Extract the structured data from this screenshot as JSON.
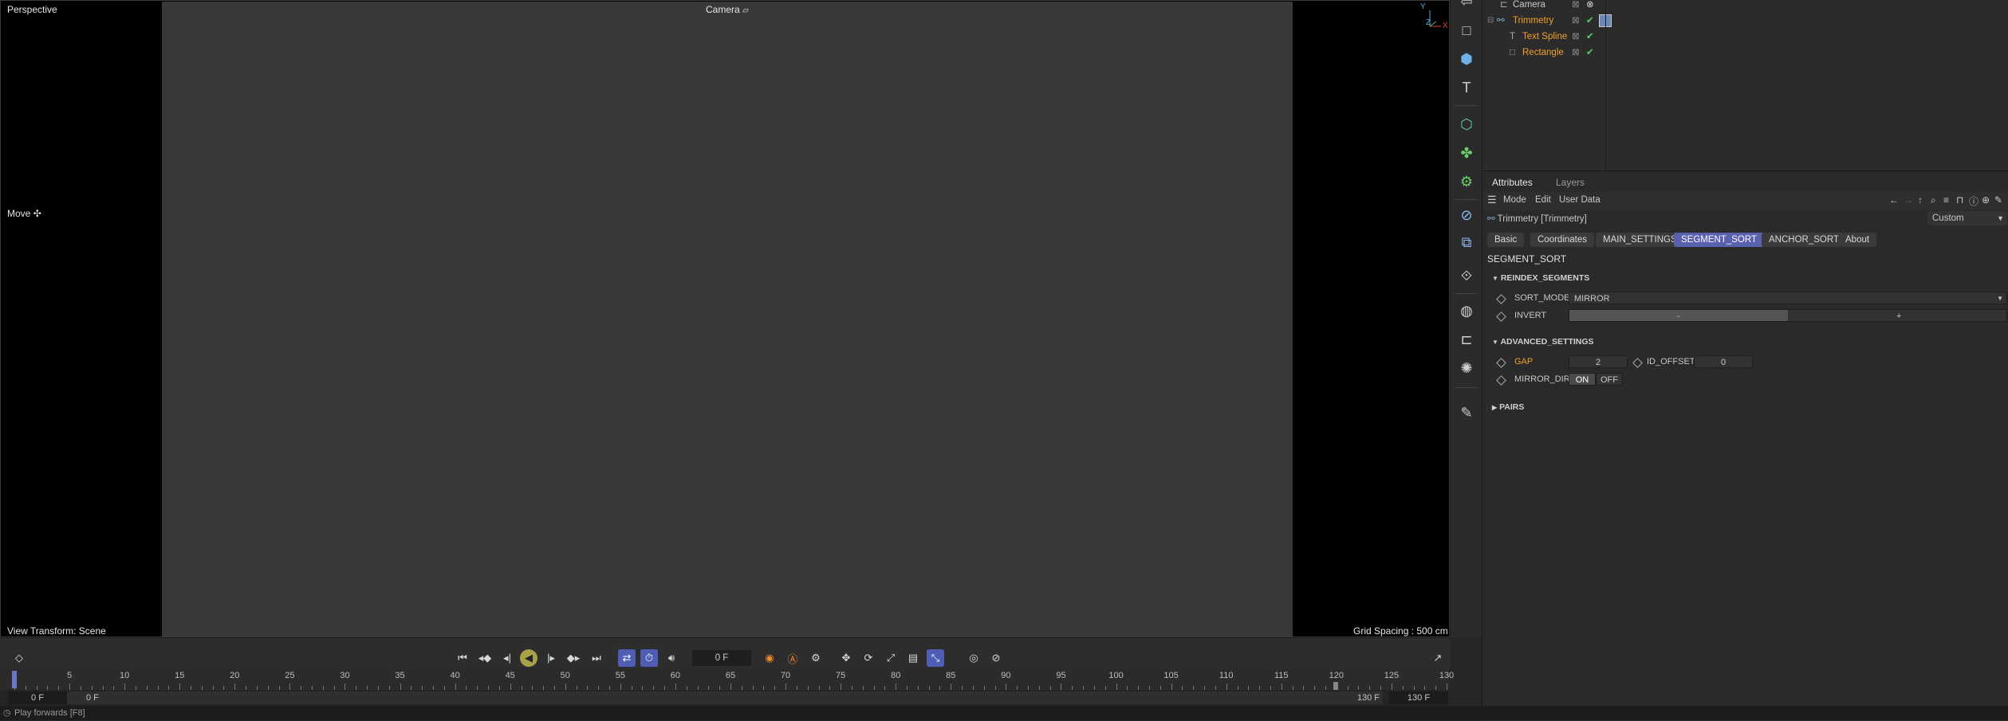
{
  "viewport": {
    "view_name": "Perspective",
    "camera_label": "Camera",
    "tool_label": "Move",
    "view_transform": "View Transform: Scene",
    "grid_spacing": "Grid Spacing : 500 cm",
    "axis_y": "Y",
    "axis_z": "Z",
    "axis_x": "X"
  },
  "object_manager": {
    "rows": [
      {
        "name": "Camera",
        "color": "#d8d8d8"
      },
      {
        "name": "Trimmetry",
        "color": "#f0a030"
      },
      {
        "name": "Text Spline",
        "color": "#f0a030"
      },
      {
        "name": "Rectangle",
        "color": "#f0a030"
      }
    ]
  },
  "attributes": {
    "tabs": [
      "Attributes",
      "Layers"
    ],
    "menu": [
      "Mode",
      "Edit",
      "User Data"
    ],
    "object_title": "Trimmetry [Trimmetry]",
    "preset": "Custom",
    "pills": [
      "Basic",
      "Coordinates",
      "MAIN_SETTINGS",
      "SEGMENT_SORT",
      "ANCHOR_SORT",
      "About"
    ],
    "active_pill": "SEGMENT_SORT",
    "section_title": "SEGMENT_SORT",
    "reindex": {
      "header": "REINDEX_SEGMENTS",
      "sort_mode_label": "SORT_MODE",
      "sort_mode_value": "MIRROR",
      "invert_label": "INVERT",
      "invert_minus": "-",
      "invert_plus": "+"
    },
    "advanced": {
      "header": "ADVANCED_SETTINGS",
      "gap_label": "GAP",
      "gap_value": "2",
      "id_offset_label": "ID_OFFSET",
      "id_offset_value": "0",
      "mirror_dir_label": "MIRROR_DIR",
      "on_label": "ON",
      "off_label": "OFF"
    },
    "pairs_header": "PAIRS"
  },
  "timeline": {
    "current_frame": "0 F",
    "ticks": [
      "0",
      "5",
      "10",
      "15",
      "20",
      "25",
      "30",
      "35",
      "40",
      "45",
      "50",
      "55",
      "60",
      "65",
      "70",
      "75",
      "80",
      "85",
      "90",
      "95",
      "100",
      "105",
      "110",
      "115",
      "120",
      "125",
      "130"
    ],
    "range_start": "0 F",
    "range_start2": "0 F",
    "range_end": "130 F",
    "range_end2": "130 F"
  },
  "status": {
    "text": "Play forwards [F8]"
  },
  "colors": {
    "accent": "#5a62b0",
    "active_object": "#f0a030",
    "check": "#4fd36a"
  }
}
